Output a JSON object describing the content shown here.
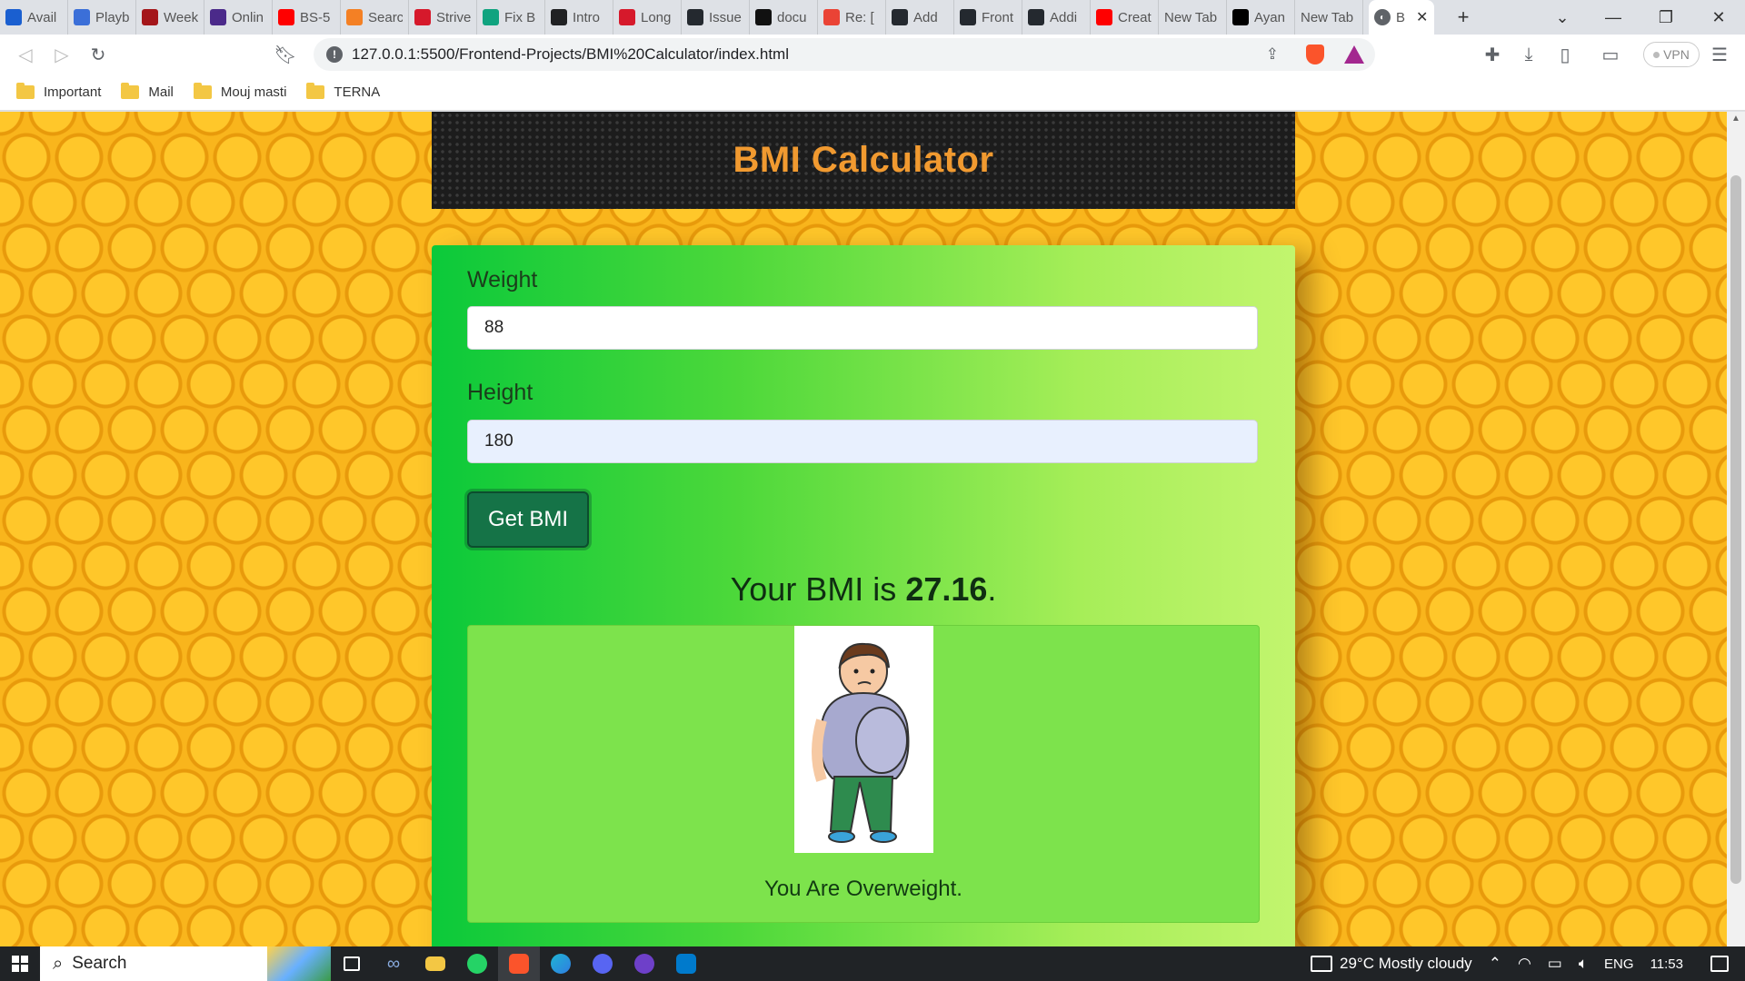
{
  "browser": {
    "tabs": [
      {
        "label": "Avail",
        "icon": "u-icon",
        "color": "#1a5fd0"
      },
      {
        "label": "Playb",
        "icon": "ux-icon",
        "color": "#3b6fd8"
      },
      {
        "label": "Week",
        "icon": "shield-icon",
        "color": "#a4161a"
      },
      {
        "label": "Onlin",
        "icon": "bolt-icon",
        "color": "#4b2a8a"
      },
      {
        "label": "BS-5",
        "icon": "youtube-icon",
        "color": "#ff0000"
      },
      {
        "label": "Searc",
        "icon": "search-site-icon",
        "color": "#f48024"
      },
      {
        "label": "Strive",
        "icon": "tuf-icon",
        "color": "#d6192b"
      },
      {
        "label": "Fix B",
        "icon": "openai-icon",
        "color": "#10a37f"
      },
      {
        "label": "Intro",
        "icon": "openai-icon",
        "color": "#202123"
      },
      {
        "label": "Long",
        "icon": "tuf-icon",
        "color": "#d6192b"
      },
      {
        "label": "Issue",
        "icon": "github-icon",
        "color": "#24292f"
      },
      {
        "label": "docu",
        "icon": "p-icon",
        "color": "#111111"
      },
      {
        "label": "Re: [",
        "icon": "gmail-icon",
        "color": "#ea4335"
      },
      {
        "label": "Add",
        "icon": "github-icon",
        "color": "#24292f"
      },
      {
        "label": "Front",
        "icon": "github-icon",
        "color": "#24292f"
      },
      {
        "label": "Addi",
        "icon": "github-icon",
        "color": "#24292f"
      },
      {
        "label": "Creat",
        "icon": "youtube-icon",
        "color": "#ff0000"
      },
      {
        "label": "New Tab",
        "icon": "",
        "color": ""
      },
      {
        "label": "Ayan",
        "icon": "medium-icon",
        "color": "#000000"
      },
      {
        "label": "New Tab",
        "icon": "",
        "color": ""
      }
    ],
    "active_tab": {
      "label": "B",
      "icon": "globe-icon"
    },
    "url": "127.0.0.1:5500/Frontend-Projects/BMI%20Calculator/index.html",
    "vpn_label": "VPN",
    "bookmarks": [
      "Important",
      "Mail",
      "Mouj masti",
      "TERNA"
    ]
  },
  "page": {
    "title": "BMI Calculator",
    "weight_label": "Weight",
    "weight_value": "88",
    "height_label": "Height",
    "height_value": "180",
    "button_label": "Get BMI",
    "result_prefix": "Your BMI is ",
    "result_value": "27.16",
    "result_suffix": ".",
    "status_text": "You Are Overweight.",
    "colors": {
      "header_title": "#f19a30",
      "button": "#157347",
      "card_start": "#0bc93a",
      "card_end": "#c2f56e"
    }
  },
  "taskbar": {
    "search_label": "Search",
    "weather": "29°C  Mostly cloudy",
    "language": "ENG",
    "time": "11:53",
    "apps": [
      "task-view-icon",
      "infinity-icon",
      "file-explorer-icon",
      "whatsapp-icon",
      "brave-icon",
      "edge-icon",
      "discord-icon",
      "github-desktop-icon",
      "vscode-icon"
    ]
  }
}
